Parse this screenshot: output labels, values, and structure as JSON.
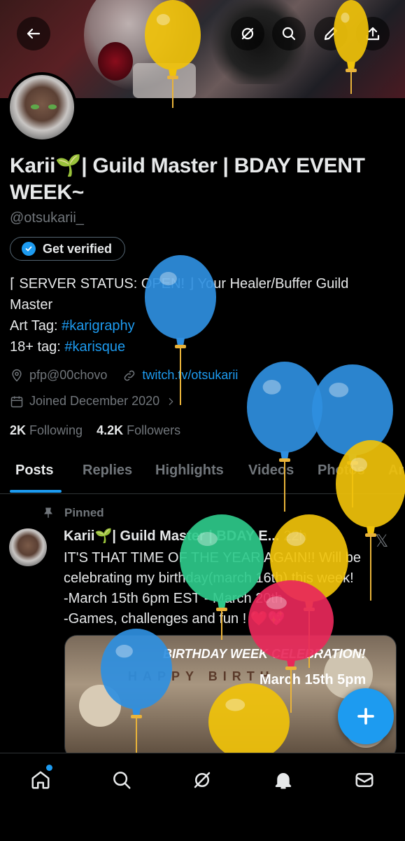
{
  "profile": {
    "display_name": "Karii🌱| Guild Master | BDAY EVENT WEEK~",
    "handle": "@otsukarii_",
    "verify_label": "Get verified",
    "bio_line1": "⌈ SERVER STATUS: OPEN! ⌋ Your Healer/Buffer Guild Master",
    "bio_art_label": "Art Tag: ",
    "bio_art_tag": "#karigraphy",
    "bio_18_label": "18+ tag: ",
    "bio_18_tag": "#karisque",
    "location": "pfp@00chovo",
    "website": "twitch.tv/otsukarii",
    "joined": "Joined December 2020",
    "following_count": "2K",
    "following_label": "Following",
    "followers_count": "4.2K",
    "followers_label": "Followers"
  },
  "tabs": [
    "Posts",
    "Replies",
    "Highlights",
    "Videos",
    "Photos",
    "Ar"
  ],
  "post": {
    "pinned_label": "Pinned",
    "author": "Karii🌱| Guild Master | BDAY E...",
    "time": "22h",
    "line1": "IT'S THAT TIME OF THE YEAR AGAIN!! Will be celebrating my birthday(march 16th) this week!",
    "line2": "-March 15th 6pm EST - March 20th",
    "line3": "-Games, challenges and fun ! ❤️💖",
    "media_title": "BIRTHDAY WEEK CELEBRATION!",
    "media_date": "March 15th 5pm",
    "media_bunting": "HAPPY BIRTH"
  },
  "icons": {
    "back": "arrow-left-icon",
    "grok": "grok-icon",
    "search": "search-icon",
    "edit": "pencil-icon",
    "share": "share-icon",
    "home": "home-icon",
    "explore": "search-icon",
    "grok_nav": "grok-icon",
    "notifications": "bell-icon",
    "messages": "mail-icon",
    "compose": "plus-icon"
  },
  "colors": {
    "accent": "#1d9bf0",
    "muted": "#71767b",
    "balloon_blue": "#2f8fe0",
    "balloon_yellow": "#f0c20a",
    "balloon_green": "#2ec98a",
    "balloon_pink": "#e8285a"
  }
}
